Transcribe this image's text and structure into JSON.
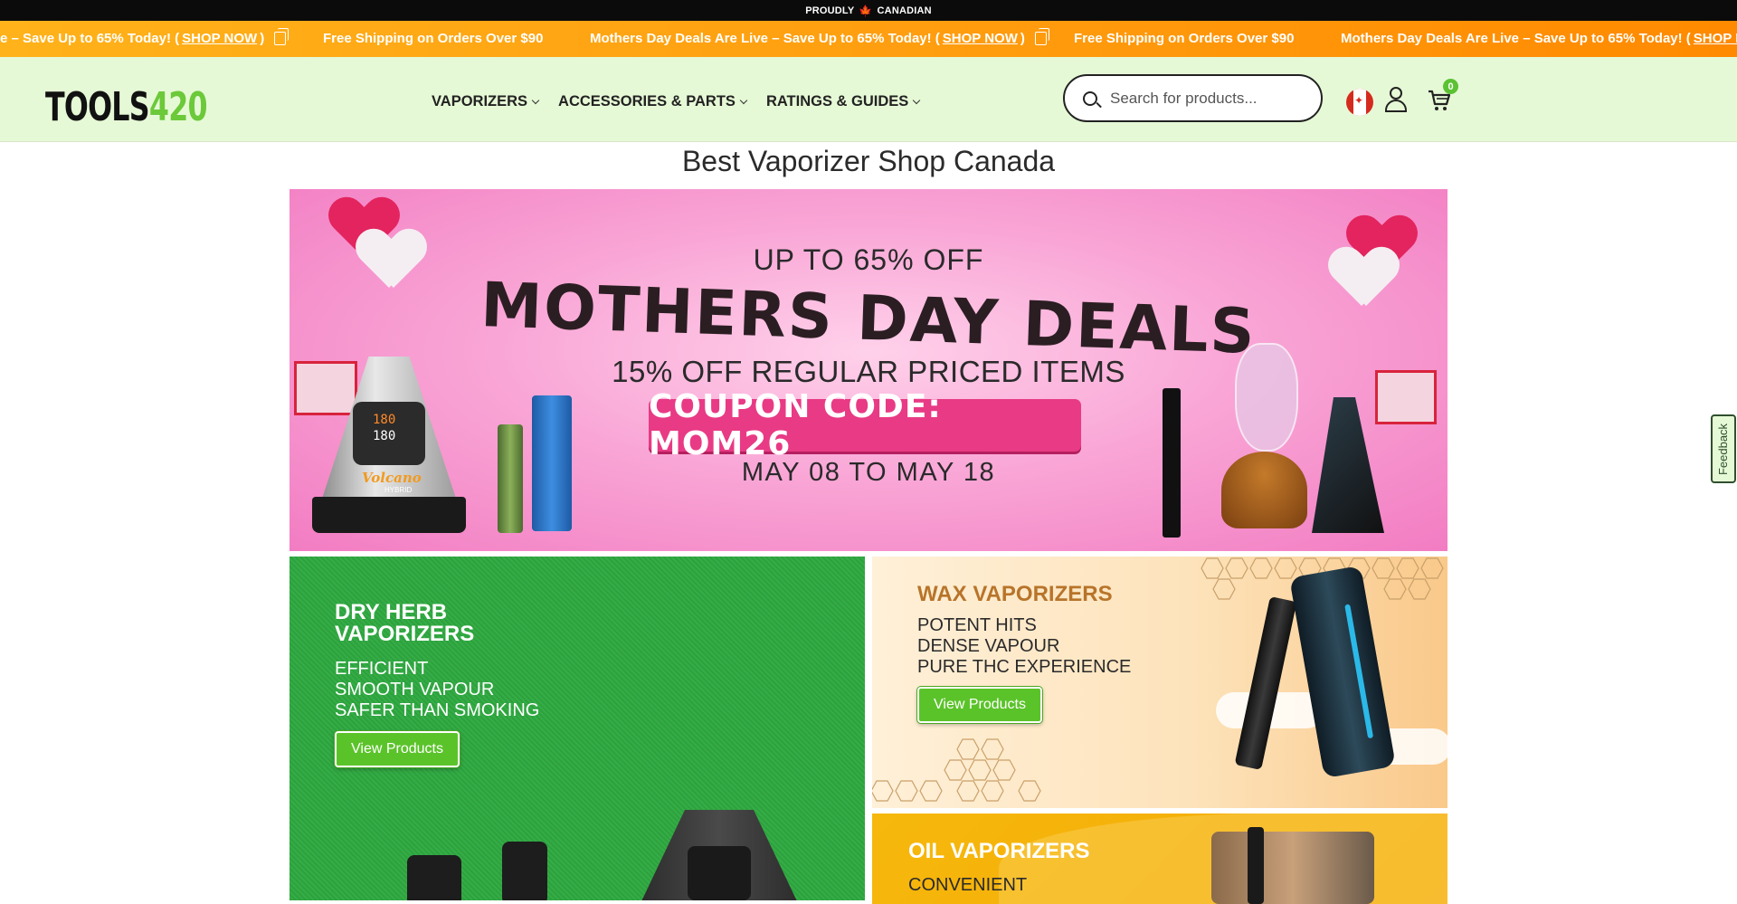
{
  "topbar": {
    "left_text": "PROUDLY",
    "right_text": "CANADIAN",
    "icon": "maple-leaf-icon"
  },
  "ticker": {
    "items": [
      {
        "text": "e – Save Up to 65% Today! (",
        "link": "SHOP NOW",
        "suffix": ")"
      },
      {
        "text": "Free Shipping on Orders Over $90"
      },
      {
        "text": "Mothers Day Deals Are Live – Save Up to 65% Today! (",
        "link": "SHOP NOW",
        "suffix": ")"
      },
      {
        "text": "Free Shipping on Orders Over $90"
      },
      {
        "text": "Mothers Day Deals Are Live – Save Up to 65% Today! (",
        "link": "SHOP NOW",
        "suffix": ""
      }
    ]
  },
  "header": {
    "logo_text": "TOOLS",
    "logo_number": "420",
    "nav": [
      {
        "label": "VAPORIZERS"
      },
      {
        "label": "ACCESSORIES & PARTS"
      },
      {
        "label": "RATINGS & GUIDES"
      }
    ],
    "search_placeholder": "Search for products...",
    "cart_count": "0"
  },
  "page_title": "Best Vaporizer Shop Canada",
  "hero": {
    "line1": "UP TO 65% OFF",
    "line2": "MOTHERS DAY DEALS",
    "line3": "15% OFF REGULAR PRICED ITEMS",
    "coupon": "COUPON CODE: MOM26",
    "line4": "MAY 08 TO MAY 18",
    "device_label": "Volcano",
    "device_sub": "HYBRID",
    "display_top": "180",
    "display_bottom": "180"
  },
  "cards": {
    "dry": {
      "title_line1": "DRY HERB",
      "title_line2": "VAPORIZERS",
      "lines": [
        "EFFICIENT",
        "SMOOTH VAPOUR",
        "SAFER THAN SMOKING"
      ],
      "button": "View Products"
    },
    "wax": {
      "title": "WAX VAPORIZERS",
      "lines": [
        "POTENT HITS",
        "DENSE VAPOUR",
        "PURE THC EXPERIENCE"
      ],
      "button": "View Products"
    },
    "oil": {
      "title": "OIL VAPORIZERS",
      "lines": [
        "CONVENIENT"
      ]
    }
  },
  "feedback_label": "Feedback",
  "colors": {
    "ticker": "#ff9f10",
    "header_bg": "#e6f9d6",
    "accent_green": "#5bc32a",
    "coupon_pink": "#e83a85",
    "wax_title": "#b8742a"
  }
}
